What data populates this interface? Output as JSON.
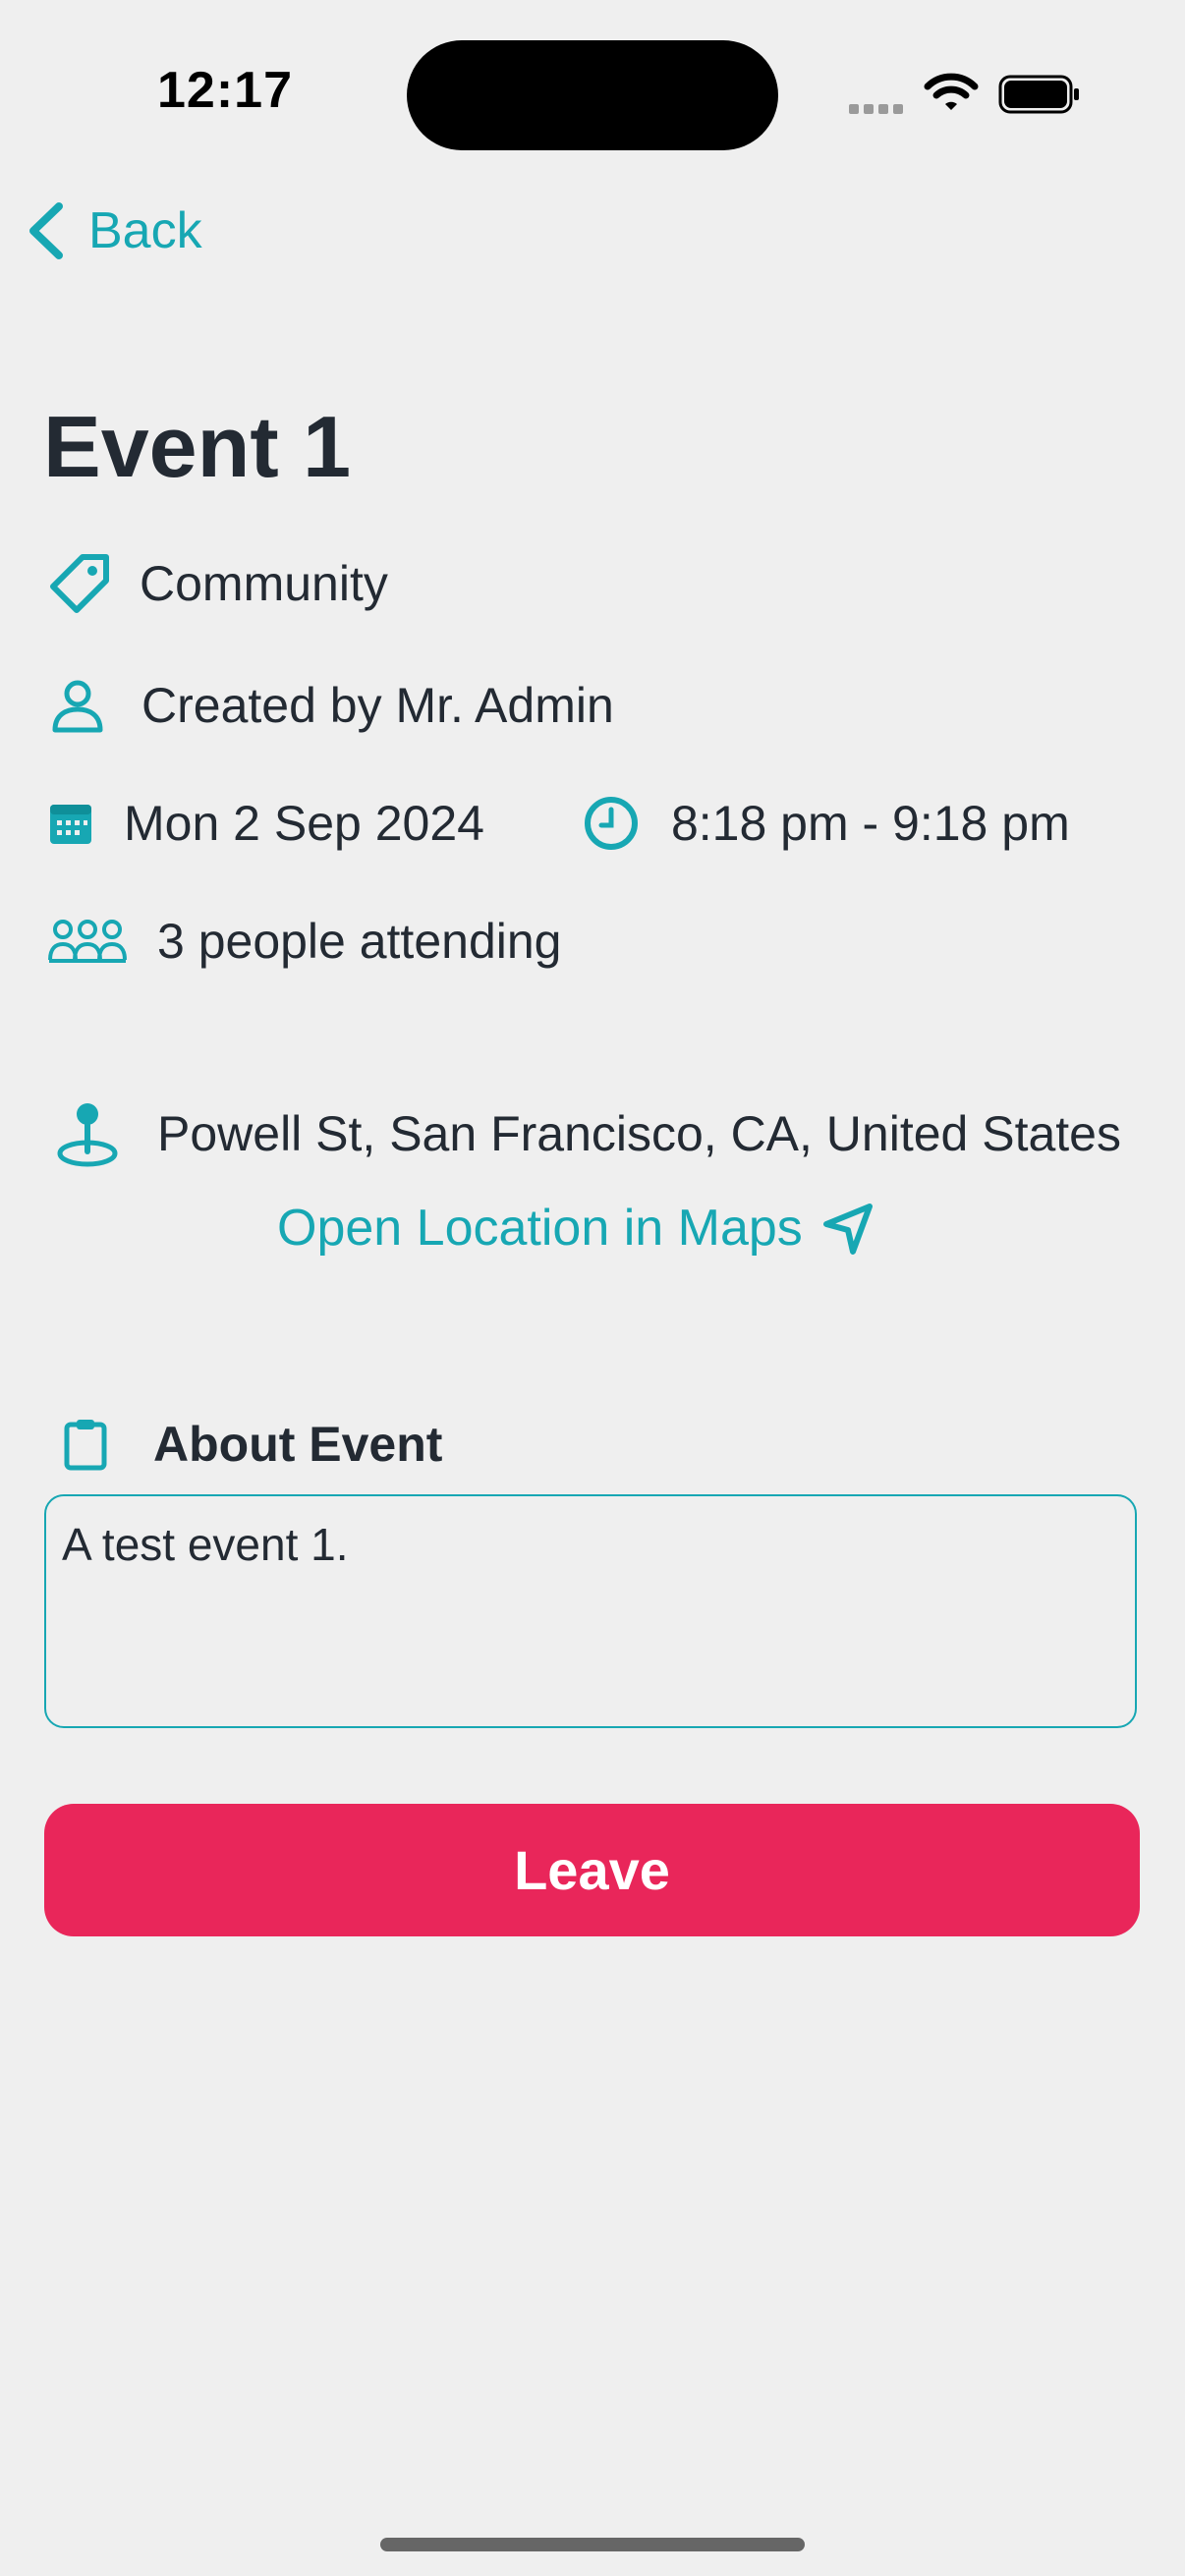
{
  "status_bar": {
    "time": "12:17"
  },
  "nav": {
    "back_label": "Back"
  },
  "event": {
    "title": "Event 1",
    "category": "Community",
    "creator": "Created by Mr. Admin",
    "date": "Mon 2 Sep 2024",
    "time_range": "8:18 pm - 9:18 pm",
    "attendees": "3 people attending",
    "location": "Powell St, San Francisco, CA, United States",
    "open_maps_label": "Open Location in Maps",
    "about_label": "About Event",
    "description": "A test event 1."
  },
  "actions": {
    "leave_label": "Leave"
  },
  "colors": {
    "accent": "#17a7b3",
    "danger": "#e9265a",
    "background": "#efefef",
    "text": "#232a33"
  },
  "icons": [
    "chevron-left-icon",
    "tag-icon",
    "user-icon",
    "calendar-icon",
    "clock-icon",
    "people-icon",
    "map-pin-icon",
    "navigation-arrow-icon",
    "clipboard-icon"
  ]
}
